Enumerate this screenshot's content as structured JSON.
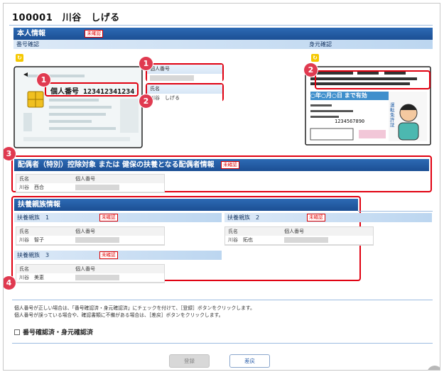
{
  "header": {
    "title": "100001　川谷　しげる"
  },
  "personal": {
    "section_title": "本人情報",
    "status": "未確認",
    "number_check_label": "番号確認",
    "id_check_label": "身元確認",
    "mynumber_card_text": "個人番号 123412341234",
    "id_card_text": "○年○月○日 まで有効",
    "id_card_number": "1234567890",
    "id_card_side_text": "運転免許証",
    "fields": {
      "number_label": "個人番号",
      "name_label": "氏名",
      "name_value": "川谷　しげる"
    }
  },
  "badges": [
    "1",
    "1",
    "2",
    "2",
    "3",
    "4"
  ],
  "spouse": {
    "section_title": "配偶者（特別）控除対象 または 健保の扶養となる配偶者情報",
    "status": "未確認",
    "col_name": "氏名",
    "col_number": "個人番号",
    "name_value": "川谷　西合"
  },
  "dependents": {
    "section_title": "扶養親族情報",
    "items": [
      {
        "title": "扶養親族　1",
        "status": "未確認",
        "col_name": "氏名",
        "col_number": "個人番号",
        "name_value": "川谷　智子"
      },
      {
        "title": "扶養親族　2",
        "status": "未確認",
        "col_name": "氏名",
        "col_number": "個人番号",
        "name_value": "川谷　拓也"
      },
      {
        "title": "扶養親族　3",
        "status": "未確認",
        "col_name": "氏名",
        "col_number": "個人番号",
        "name_value": "川谷　美恵"
      }
    ]
  },
  "notes": {
    "line1": "個人番号が正しい場合は、「番号確認済・身元確認済」にチェックを付けて、［登録］ボタンをクリックします。",
    "line2": "個人番号が誤っている場合や、確認書類に不備がある場合は、［差戻］ボタンをクリックします。"
  },
  "confirm": {
    "label": "番号確認済・身元確認済"
  },
  "buttons": {
    "register": "登録",
    "reject": "差戻"
  }
}
